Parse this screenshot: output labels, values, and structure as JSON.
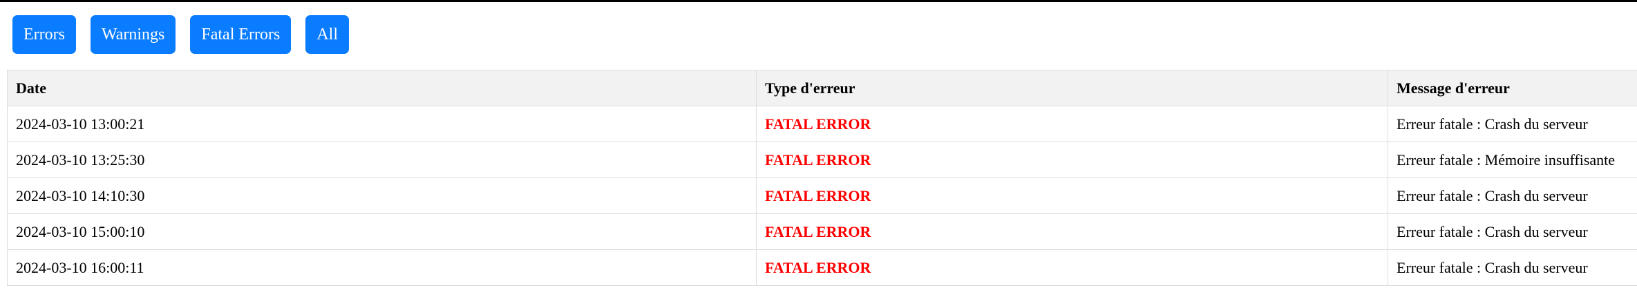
{
  "filters": [
    {
      "label": "Errors"
    },
    {
      "label": "Warnings"
    },
    {
      "label": "Fatal Errors"
    },
    {
      "label": "All"
    }
  ],
  "table": {
    "headers": {
      "date": "Date",
      "type": "Type d'erreur",
      "message": "Message d'erreur"
    },
    "rows": [
      {
        "date": "2024-03-10 13:00:21",
        "type": "FATAL ERROR",
        "message": "Erreur fatale : Crash du serveur"
      },
      {
        "date": "2024-03-10 13:25:30",
        "type": "FATAL ERROR",
        "message": "Erreur fatale : Mémoire insuffisante"
      },
      {
        "date": "2024-03-10 14:10:30",
        "type": "FATAL ERROR",
        "message": "Erreur fatale : Crash du serveur"
      },
      {
        "date": "2024-03-10 15:00:10",
        "type": "FATAL ERROR",
        "message": "Erreur fatale : Crash du serveur"
      },
      {
        "date": "2024-03-10 16:00:11",
        "type": "FATAL ERROR",
        "message": "Erreur fatale : Crash du serveur"
      }
    ]
  },
  "colors": {
    "button_bg": "#0a7cff",
    "fatal_text": "#ff0000",
    "header_bg": "#f2f2f2"
  }
}
